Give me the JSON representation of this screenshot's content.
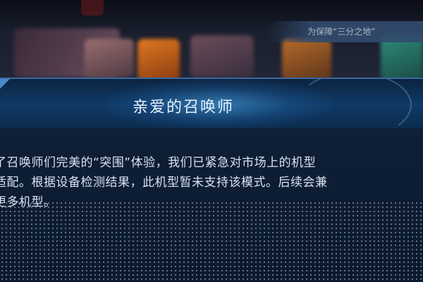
{
  "background": {
    "banner_text": "为保障“三分之地”"
  },
  "dialog": {
    "title": "亲爱的召唤师",
    "body_lines": [
      "了召唤师们完美的“突围”体验，我们已紧急对市场上的机型",
      "适配。根据设备检测结果，此机型暂未支持该模式。后续会兼",
      "更多机型。"
    ]
  },
  "colors": {
    "title_bar": "#0f3a66",
    "title_text": "#e8f2ff",
    "body_bg": "#0a1a30",
    "body_text": "#d8e2f0"
  }
}
